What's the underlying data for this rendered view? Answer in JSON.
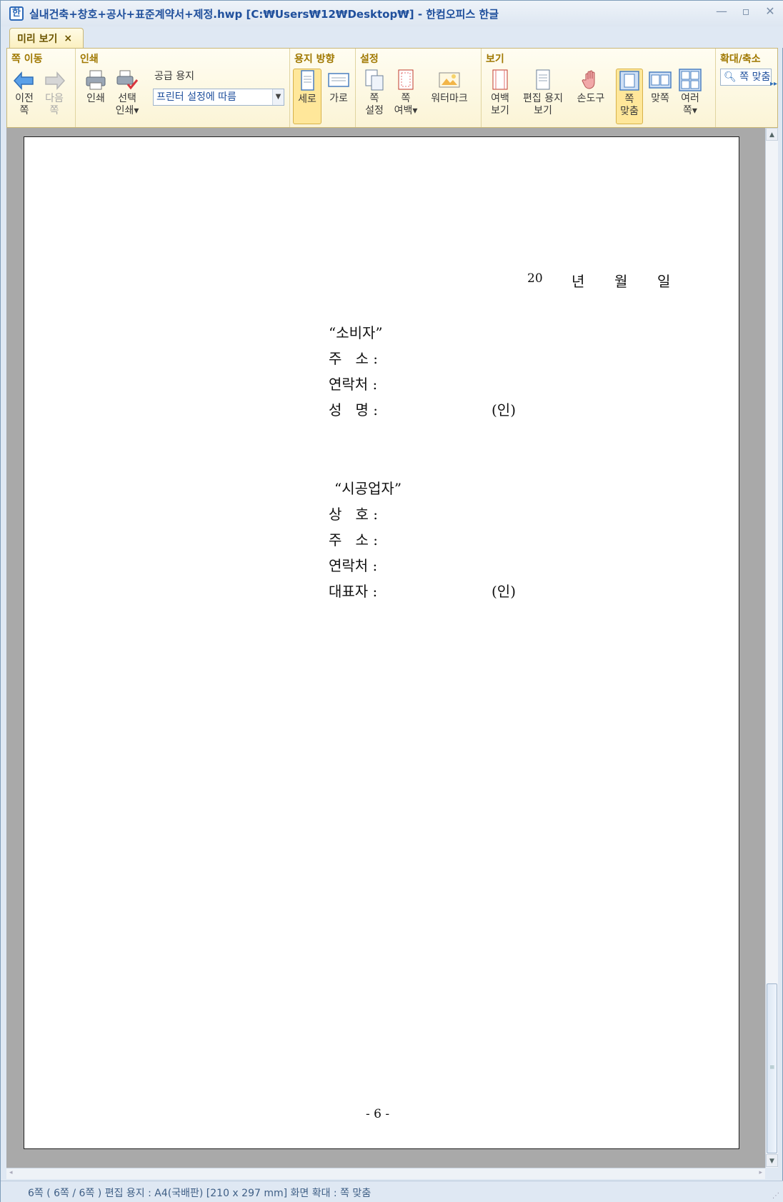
{
  "window": {
    "title": "실내건축+창호+공사+표준계약서+제정.hwp [C:₩Users₩12₩Desktop₩] - 한컴오피스 한글",
    "icon": "hwp-app-icon"
  },
  "tabs": [
    {
      "label": "미리 보기",
      "close": "×"
    }
  ],
  "ribbon": {
    "page_nav": {
      "title": "쪽 이동",
      "prev": [
        "이전",
        "쪽"
      ],
      "next": [
        "다음",
        "쪽"
      ]
    },
    "print": {
      "title": "인쇄",
      "print_label": "인쇄",
      "select_print": [
        "선택",
        "인쇄▾"
      ],
      "paper_label": "공급 용지",
      "paper_value": "프린터 설정에 따름"
    },
    "orientation": {
      "title": "용지 방향",
      "portrait": "세로",
      "landscape": "가로"
    },
    "settings": {
      "title": "설정",
      "page_setup": [
        "쪽",
        "설정"
      ],
      "page_margin": [
        "쪽",
        "여백▾"
      ],
      "watermark": "워터마크"
    },
    "view": {
      "title": "보기",
      "margin_view": [
        "여백",
        "보기"
      ],
      "edit_paper_view": [
        "편집 용지",
        "보기"
      ],
      "hand_tool": "손도구",
      "fit_page": [
        "쪽",
        "맞춤"
      ],
      "facing": "맞쪽",
      "multi": [
        "여러",
        "쪽▾"
      ]
    },
    "zoom": {
      "title": "확대/축소",
      "value": "쪽 맞춤"
    }
  },
  "document": {
    "date_line": {
      "year": "20",
      "y": "년",
      "m": "월",
      "d": "일"
    },
    "consumer": {
      "heading": "“소비자”",
      "address_label": "주   소 :",
      "contact_label": "연락처 :",
      "name_label": "성   명 :",
      "seal": "(인)"
    },
    "contractor": {
      "heading": "“시공업자”",
      "company_label": "상   호 :",
      "address_label": "주   소 :",
      "contact_label": "연락처 :",
      "rep_label": "대표자 :",
      "seal": "(인)"
    },
    "page_number": "- 6 -"
  },
  "statusbar": {
    "text": "6쪽 ( 6쪽 / 6쪽 ) 편집 용지 : A4(국배판)  [210 x 297 mm]  화면 확대 : 쪽 맞춤"
  },
  "colors": {
    "ribbon_bg": "#fbf4d6",
    "group_title": "#a07800",
    "accent_blue": "#1f4f9c"
  }
}
